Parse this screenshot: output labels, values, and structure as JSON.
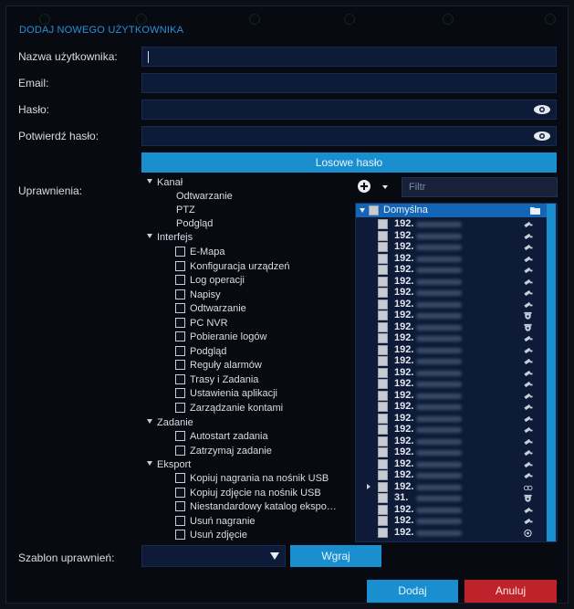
{
  "dialog": {
    "title": "DODAJ NOWEGO UŻYTKOWNIKA",
    "labels": {
      "username": "Nazwa użytkownika:",
      "email": "Email:",
      "password": "Hasło:",
      "confirm_password": "Potwierdź hasło:",
      "permissions": "Uprawnienia:",
      "permission_template": "Szablon uprawnień:"
    },
    "fields": {
      "username_value": "",
      "email_value": "",
      "password_value": "",
      "confirm_password_value": ""
    },
    "random_password_button": "Losowe hasło",
    "load_button": "Wgraj",
    "add_button": "Dodaj",
    "cancel_button": "Anuluj",
    "template_selected": ""
  },
  "permissions_tree": {
    "groups": [
      {
        "label": "Kanał",
        "items": [
          "Odtwarzanie",
          "PTZ",
          "Podgląd"
        ],
        "checkbox": false
      },
      {
        "label": "Interfejs",
        "items": [
          "E-Mapa",
          "Konfiguracja urządzeń",
          "Log operacji",
          "Napisy",
          "Odtwarzanie",
          "PC NVR",
          "Pobieranie logów",
          "Podgląd",
          "Reguły alarmów",
          "Trasy i Zadania",
          "Ustawienia aplikacji",
          "Zarządzanie kontami"
        ],
        "checkbox": true
      },
      {
        "label": "Zadanie",
        "items": [
          "Autostart zadania",
          "Zatrzymaj zadanie"
        ],
        "checkbox": true
      },
      {
        "label": "Eksport",
        "items": [
          "Kopiuj nagrania na nośnik USB",
          "Kopiuj zdjęcie na nośnik USB",
          "Niestandardowy katalog ekspo…",
          "Usuń nagranie",
          "Usuń zdjęcie"
        ],
        "checkbox": true
      }
    ]
  },
  "resources": {
    "filter_placeholder": "Filtr",
    "group_label": "Domyślna",
    "devices": [
      {
        "ip": "192.",
        "icon": "camera-icon"
      },
      {
        "ip": "192.",
        "icon": "camera-icon"
      },
      {
        "ip": "192.",
        "icon": "camera-icon"
      },
      {
        "ip": "192.",
        "icon": "camera-icon"
      },
      {
        "ip": "192.",
        "icon": "camera-icon"
      },
      {
        "ip": "192.",
        "icon": "camera-icon"
      },
      {
        "ip": "192.",
        "icon": "camera-icon"
      },
      {
        "ip": "192.",
        "icon": "camera-icon"
      },
      {
        "ip": "192.",
        "icon": "dome-camera-icon"
      },
      {
        "ip": "192.",
        "icon": "dome-camera-icon"
      },
      {
        "ip": "192.",
        "icon": "camera-icon"
      },
      {
        "ip": "192.",
        "icon": "camera-icon"
      },
      {
        "ip": "192.",
        "icon": "camera-icon"
      },
      {
        "ip": "192.",
        "icon": "camera-icon"
      },
      {
        "ip": "192.",
        "icon": "camera-icon"
      },
      {
        "ip": "192.",
        "icon": "camera-icon"
      },
      {
        "ip": "192.",
        "icon": "camera-icon"
      },
      {
        "ip": "192.",
        "icon": "camera-icon"
      },
      {
        "ip": "192.",
        "icon": "camera-icon"
      },
      {
        "ip": "192.",
        "icon": "camera-icon"
      },
      {
        "ip": "192.",
        "icon": "camera-icon"
      },
      {
        "ip": "192.",
        "icon": "camera-icon"
      },
      {
        "ip": "192.",
        "icon": "camera-icon"
      },
      {
        "ip": "192.",
        "icon": "nvr-icon"
      },
      {
        "ip": "31.",
        "icon": "dome-camera-icon"
      },
      {
        "ip": "192.",
        "icon": "camera-icon"
      },
      {
        "ip": "192.",
        "icon": "camera-icon"
      },
      {
        "ip": "192.",
        "icon": "fisheye-icon"
      }
    ]
  },
  "colors": {
    "accent": "#1a8fd0",
    "danger": "#c0222b",
    "field_bg": "#0d1b38",
    "background": "#070b11"
  }
}
